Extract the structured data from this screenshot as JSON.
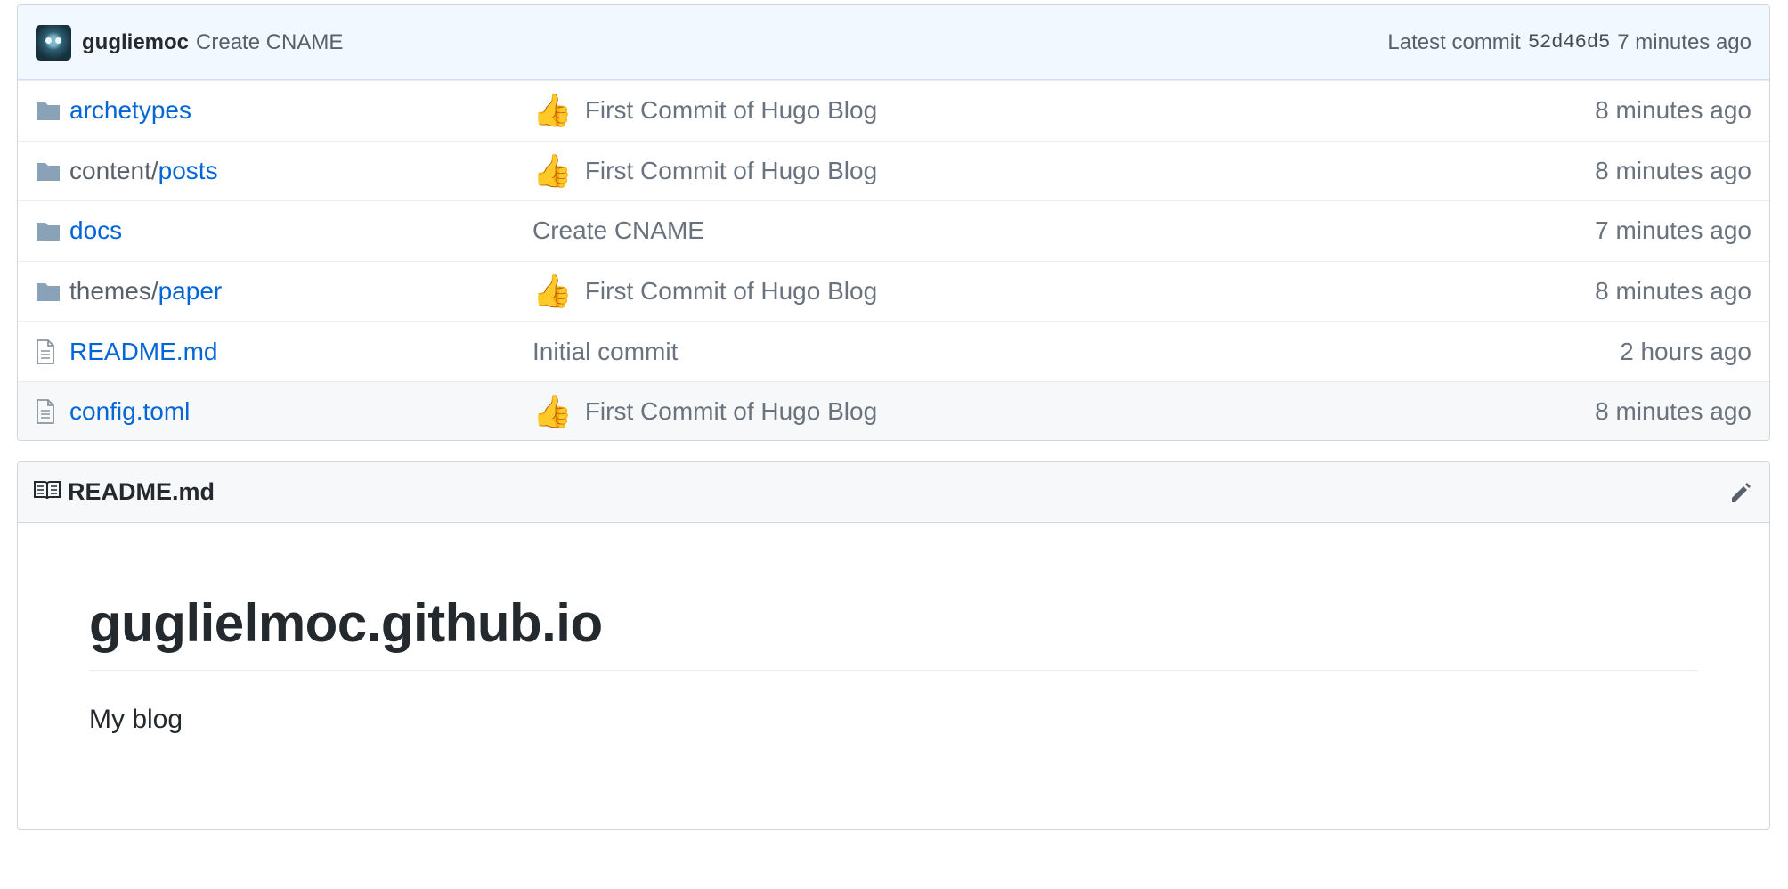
{
  "commit": {
    "author": "gugliemoc",
    "message": "Create CNAME",
    "latest_label": "Latest commit",
    "sha": "52d46d5",
    "age": "7 minutes ago"
  },
  "files": [
    {
      "type": "folder",
      "prefix": "",
      "name": "archetypes",
      "emoji": "👍",
      "message": "First Commit of Hugo Blog",
      "age": "8 minutes ago"
    },
    {
      "type": "folder",
      "prefix": "content/",
      "name": "posts",
      "emoji": "👍",
      "message": "First Commit of Hugo Blog",
      "age": "8 minutes ago"
    },
    {
      "type": "folder",
      "prefix": "",
      "name": "docs",
      "emoji": "",
      "message": "Create CNAME",
      "age": "7 minutes ago"
    },
    {
      "type": "folder",
      "prefix": "themes/",
      "name": "paper",
      "emoji": "👍",
      "message": "First Commit of Hugo Blog",
      "age": "8 minutes ago"
    },
    {
      "type": "file",
      "prefix": "",
      "name": "README.md",
      "emoji": "",
      "message": "Initial commit",
      "age": "2 hours ago"
    },
    {
      "type": "file",
      "prefix": "",
      "name": "config.toml",
      "emoji": "👍",
      "message": "First Commit of Hugo Blog",
      "age": "8 minutes ago"
    }
  ],
  "readme": {
    "filename": "README.md",
    "heading": "guglielmoc.github.io",
    "body": "My blog"
  },
  "colors": {
    "link": "#0366d6",
    "muted": "#6a737d",
    "commit_bg": "#f1f8ff"
  },
  "icons": {
    "folder": "folder-icon",
    "file": "file-icon",
    "readme": "book-icon",
    "edit": "pencil-icon"
  }
}
